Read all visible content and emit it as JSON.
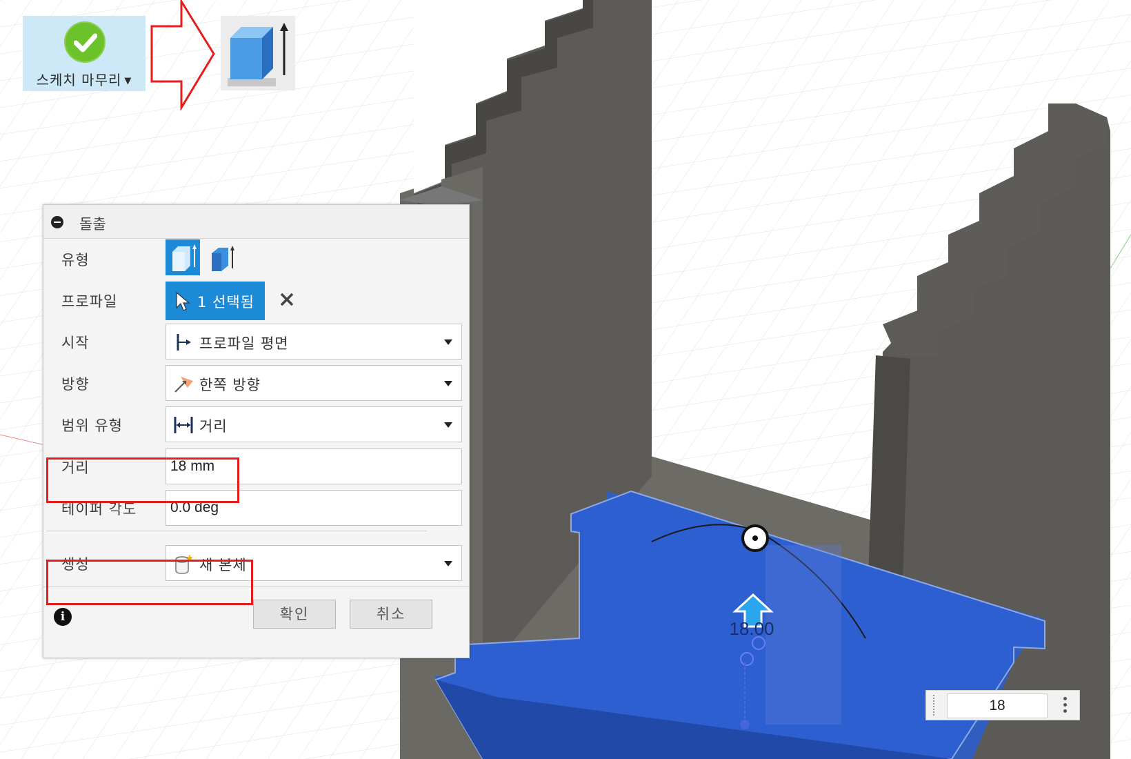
{
  "toolbar": {
    "finish_sketch_label": "스케치 마무리",
    "finish_sketch_icon": "check-circle-icon",
    "arrow_icon": "right-arrow-outline-icon",
    "extrude_icon": "extrude-icon"
  },
  "panel": {
    "title": "돌출",
    "rows": {
      "type": {
        "label": "유형"
      },
      "profile": {
        "label": "프로파일",
        "selection": "1 선택됨"
      },
      "start": {
        "label": "시작",
        "value": "프로파일 평면"
      },
      "direction": {
        "label": "방향",
        "value": "한쪽 방향"
      },
      "extent_type": {
        "label": "범위 유형",
        "value": "거리"
      },
      "distance": {
        "label": "거리",
        "value": "18 mm"
      },
      "taper_angle": {
        "label": "테이퍼 각도",
        "value": "0.0 deg"
      },
      "operation": {
        "label": "생성",
        "value": "새 본체"
      }
    },
    "ok_label": "확인",
    "cancel_label": "취소"
  },
  "viewport": {
    "dimension_label": "18.00",
    "distance_input_value": "18"
  },
  "colors": {
    "accent": "#1d8ad8",
    "highlight": "#e51d1d",
    "body": "#5c5a55",
    "profile": "#2f5fc4"
  }
}
